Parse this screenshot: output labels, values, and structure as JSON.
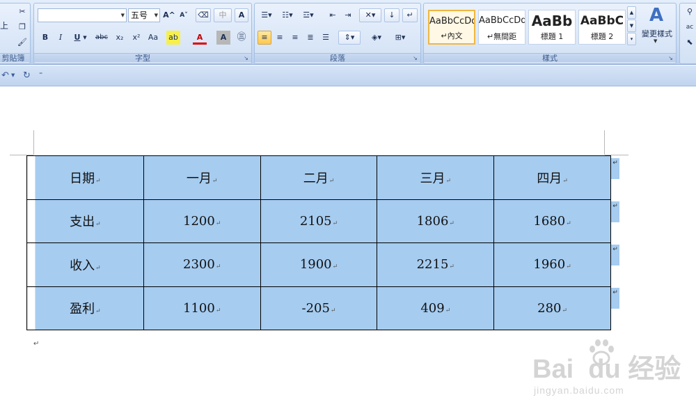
{
  "ribbon": {
    "clipboard": {
      "label": "剪貼簿",
      "paste_partial": "上"
    },
    "font": {
      "label": "字型",
      "name_value": "",
      "size_value": "五号",
      "grow_icon": "A^",
      "shrink_icon": "A˅",
      "bold": "B",
      "italic": "I",
      "underline": "U",
      "strike": "abc",
      "subscript": "x₂",
      "superscript": "x²",
      "change_case": "Aa",
      "font_color": "A",
      "char_shade": "A",
      "enclose": "㊂"
    },
    "paragraph": {
      "label": "段落"
    },
    "styles": {
      "label": "樣式",
      "items": [
        {
          "sample": "AaBbCcDd",
          "name": "↵內文",
          "selected": true
        },
        {
          "sample": "AaBbCcDd",
          "name": "↵無間距",
          "selected": false
        },
        {
          "sample": "AaBb",
          "name": "標題 1",
          "selected": false
        },
        {
          "sample": "AaBbC",
          "name": "標題 2",
          "selected": false
        }
      ],
      "change_styles_label": "變更樣式"
    }
  },
  "qat": {
    "undo": "↶",
    "redo": "↻",
    "customize": "⁼"
  },
  "table": {
    "rows": [
      [
        "日期",
        "一月",
        "二月",
        "三月",
        "四月"
      ],
      [
        "支出",
        "1200",
        "2105",
        "1806",
        "1680"
      ],
      [
        "收入",
        "2300",
        "1900",
        "2215",
        "1960"
      ],
      [
        "盈利",
        "1100",
        "-205",
        "409",
        "280"
      ]
    ],
    "cell_mark": "↵"
  },
  "paragraph_mark": "↵",
  "watermark": {
    "logo": "Bai  du 经验",
    "sub": "jingyan.baidu.com"
  },
  "colors": {
    "ribbon_bg": "#c6d9f1",
    "table_fill": "#a6ccf0",
    "selected_style": "#f1b740"
  }
}
